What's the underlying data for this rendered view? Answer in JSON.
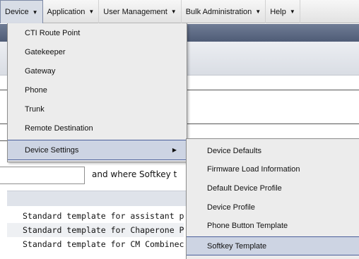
{
  "menubar": {
    "items": [
      {
        "label": "Device",
        "caret": "▼"
      },
      {
        "label": "Application",
        "caret": "▼"
      },
      {
        "label": "User Management",
        "caret": "▼"
      },
      {
        "label": "Bulk Administration",
        "caret": "▼"
      },
      {
        "label": "Help",
        "caret": "▼"
      }
    ]
  },
  "device_menu": {
    "items": [
      {
        "label": "CTI Route Point"
      },
      {
        "label": "Gatekeeper"
      },
      {
        "label": "Gateway"
      },
      {
        "label": "Phone"
      },
      {
        "label": "Trunk"
      },
      {
        "label": "Remote Destination"
      },
      {
        "label": "Device Settings",
        "arrow": "▶"
      }
    ]
  },
  "device_settings_submenu": {
    "items": [
      {
        "label": "Device Defaults"
      },
      {
        "label": "Firmware Load Information"
      },
      {
        "label": "Default Device Profile"
      },
      {
        "label": "Device Profile"
      },
      {
        "label": "Phone Button Template"
      },
      {
        "label": "Softkey Template"
      }
    ]
  },
  "background_page": {
    "filter_text": "and where Softkey t",
    "rows": [
      "Standard template for assistant phc",
      "Standard template for Chaperone Pl",
      "Standard template for CM Combinec"
    ]
  }
}
